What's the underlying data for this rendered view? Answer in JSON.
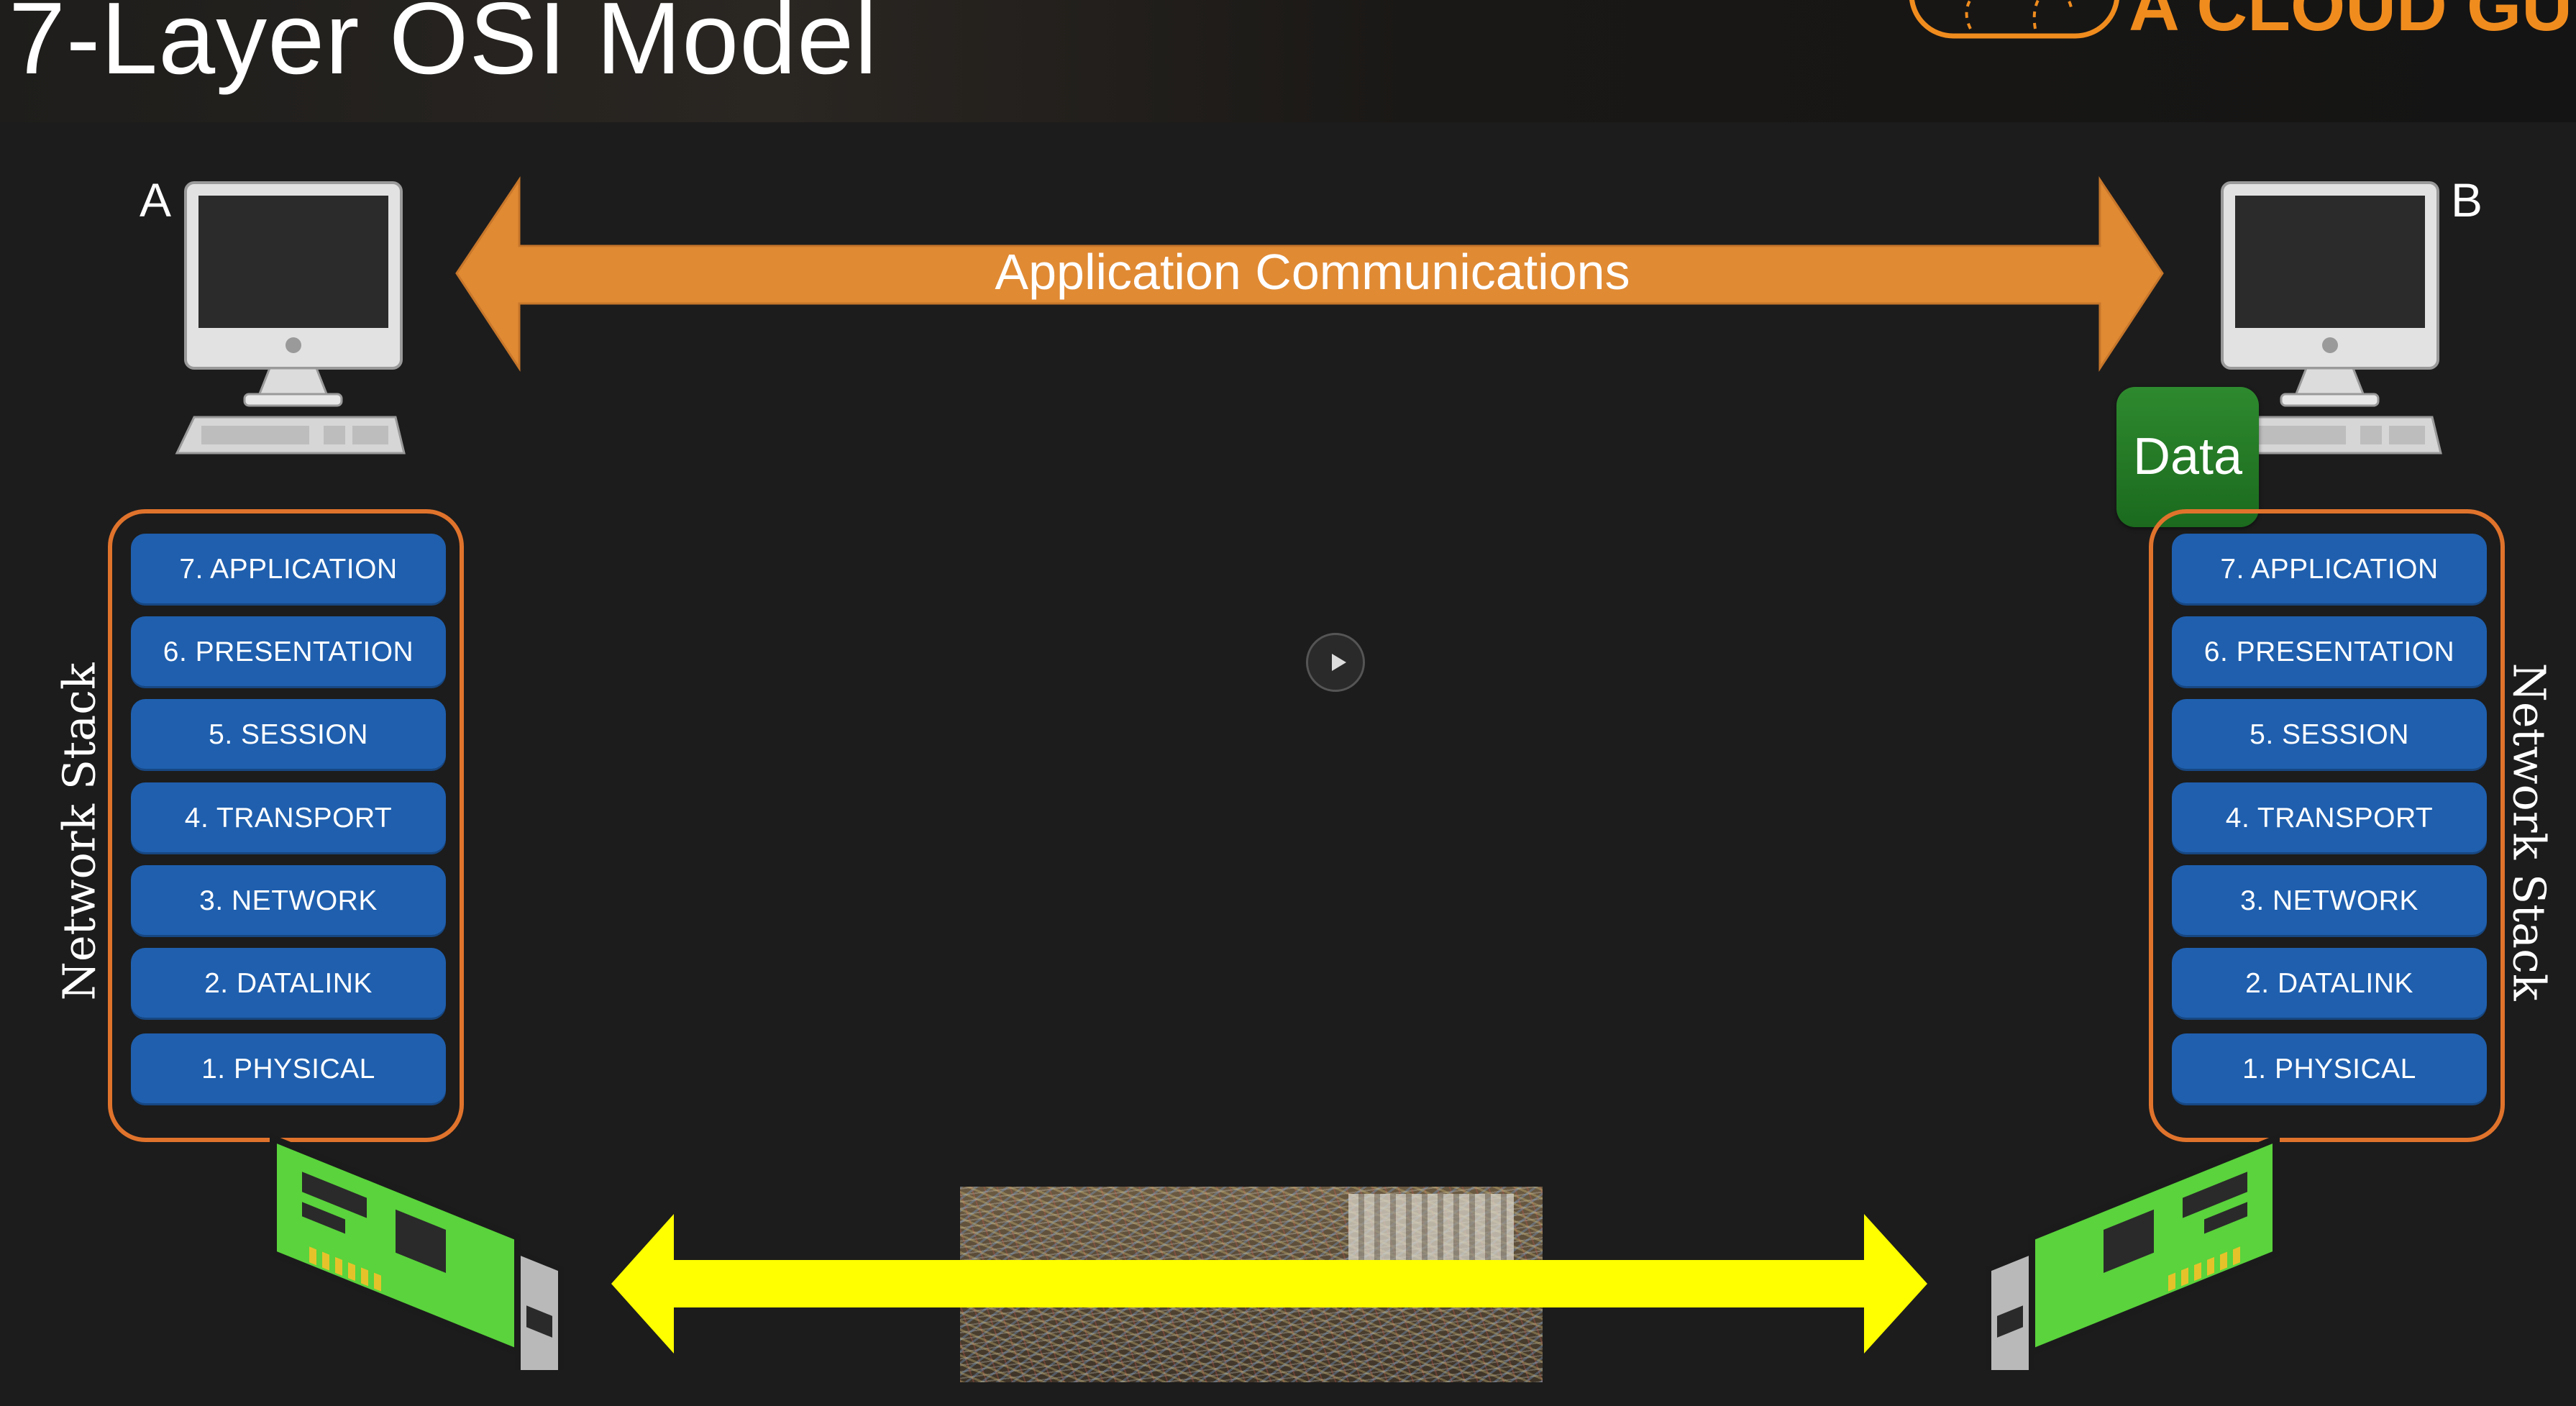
{
  "slide": {
    "title": "7-Layer OSI Model"
  },
  "brand": {
    "logo_text": "A CLOUD GUR",
    "accent_color": "#f08c1e"
  },
  "hosts": {
    "a": {
      "label": "A"
    },
    "b": {
      "label": "B"
    }
  },
  "arrows": {
    "application": {
      "label": "Application Communications",
      "color": "#e08a34"
    },
    "physical": {
      "color": "#ffff00"
    }
  },
  "data_badge": {
    "label": "Data",
    "color": "#2e8a2e"
  },
  "stack_label": "Network Stack",
  "layers": [
    "7. APPLICATION",
    "6. PRESENTATION",
    "5. SESSION",
    "4. TRANSPORT",
    "3. NETWORK",
    "2. DATALINK",
    "1. PHYSICAL"
  ],
  "layer_color": "#1f5fae",
  "stack_border_color": "#e0732c",
  "icons": {
    "computer": "computer-icon",
    "nic": "network-card-icon",
    "play": "play-icon",
    "cloud": "cloud-logo-icon"
  }
}
